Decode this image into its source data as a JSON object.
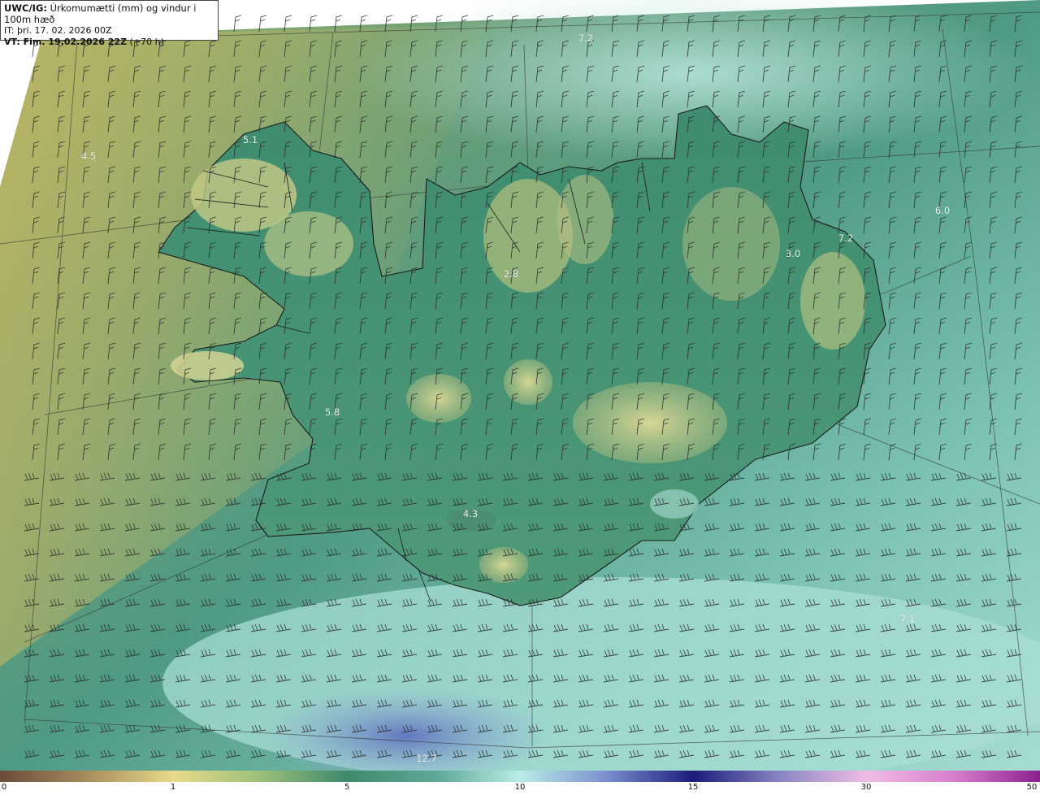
{
  "info_box": {
    "header_model": "UWC/IG:",
    "header_title": "Úrkomumætti (mm) og vindur i 100m hæð",
    "init_time": "IT: þri. 17. 02. 2026 00Z",
    "valid_prefix": "VT: Fim. 19.02.2026 22Z",
    "valid_suffix": " (+70 h)"
  },
  "map_labels": [
    {
      "id": "label-7-2-north",
      "text": "7.2"
    },
    {
      "id": "label-5-1",
      "text": "5.1"
    },
    {
      "id": "label-4-5",
      "text": "4.5"
    },
    {
      "id": "label-6-0",
      "text": "6.0"
    },
    {
      "id": "label-7-2-east",
      "text": "7.2"
    },
    {
      "id": "label-3-0",
      "text": "3.0"
    },
    {
      "id": "label-2-8",
      "text": "2.8"
    },
    {
      "id": "label-5-8",
      "text": "5.8"
    },
    {
      "id": "label-4-3",
      "text": "4.3"
    },
    {
      "id": "label-7-1",
      "text": "7.1"
    },
    {
      "id": "label-12-7",
      "text": "12.7"
    }
  ],
  "legend": {
    "ticks": [
      "0",
      "1",
      "5",
      "10",
      "15",
      "30",
      "50"
    ]
  },
  "colors": {
    "sea_light": "#a9dcd4",
    "sea_mid": "#5fa898",
    "land_dark": "#3e8a6e",
    "land_high": "#c9cf88",
    "west_yellow": "#b7b567",
    "heavy_blue": "#6f86c4",
    "coastline": "#1a1a1a"
  }
}
